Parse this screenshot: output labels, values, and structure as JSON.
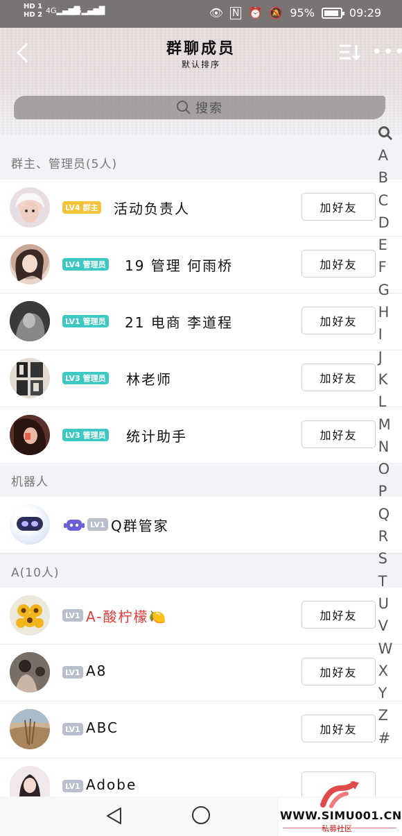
{
  "status_bar": {
    "sim1": "HD 1",
    "sim2": "HD 2",
    "net1": "4G",
    "net2": "4G",
    "battery_percent": "95%",
    "time": "09:29"
  },
  "header": {
    "title": "群聊成员",
    "subtitle": "默认排序"
  },
  "search": {
    "placeholder": "搜索"
  },
  "sections": {
    "owners": "群主、管理员(5人)",
    "robots": "机器人",
    "a_group": "A(10人)"
  },
  "add_friend_label": "加好友",
  "members": [
    {
      "level": "LV4",
      "role": "群主",
      "name": "活动负责人"
    },
    {
      "level": "LV4",
      "role": "管理员",
      "name": "19 管理 何雨桥"
    },
    {
      "level": "LV1",
      "role": "管理员",
      "name": "21 电商 李道程"
    },
    {
      "level": "LV3",
      "role": "管理员",
      "name": "林老师"
    },
    {
      "level": "LV3",
      "role": "管理员",
      "name": "统计助手"
    }
  ],
  "robot": {
    "level": "LV1",
    "name": "Q群管家"
  },
  "a_members": [
    {
      "level": "LV1",
      "name": "A-酸柠檬🍋"
    },
    {
      "level": "LV1",
      "name": "A8"
    },
    {
      "level": "LV1",
      "name": "ABC"
    },
    {
      "level": "LV1",
      "name": "Adobe"
    }
  ],
  "index_letters": [
    "A",
    "B",
    "C",
    "D",
    "E",
    "F",
    "G",
    "H",
    "I",
    "J",
    "K",
    "L",
    "M",
    "N",
    "O",
    "P",
    "Q",
    "R",
    "S",
    "T",
    "U",
    "V",
    "W",
    "X",
    "Y",
    "Z",
    "#"
  ],
  "watermark": {
    "text": "WWW.SIMU001.CN",
    "sub": "私募社区"
  },
  "colors": {
    "owner_badge": "#f5c33a",
    "admin_badge": "#3ec8c4",
    "member_badge": "#b9bfcc",
    "red_name": "#e53935"
  }
}
